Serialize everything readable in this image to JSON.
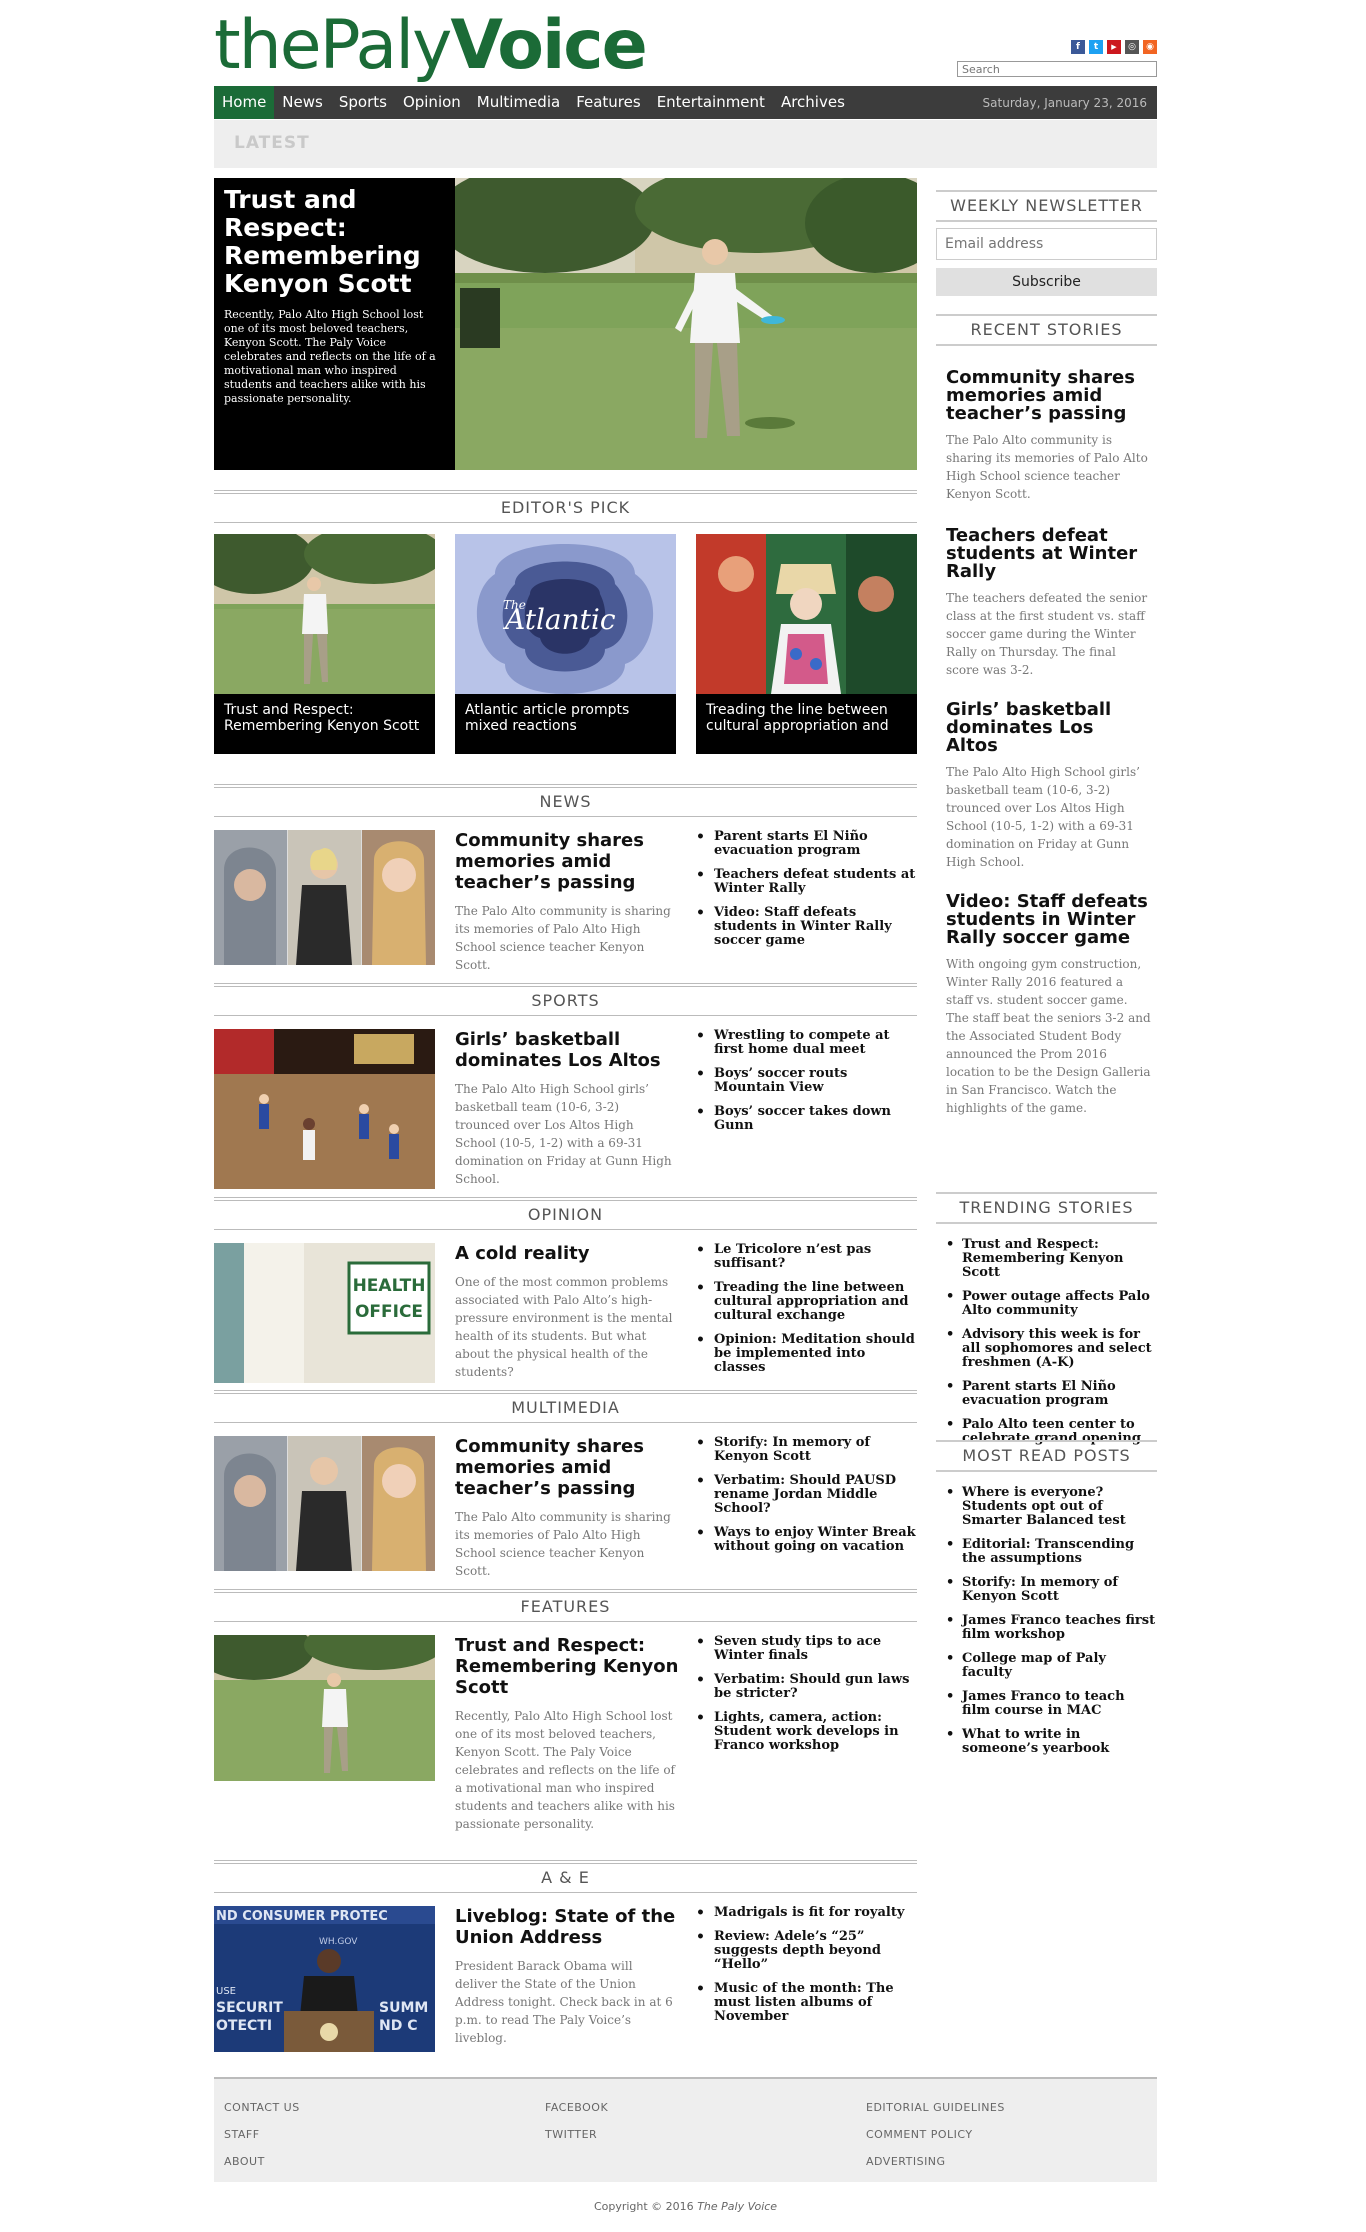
{
  "header": {
    "logo_part1": "the",
    "logo_part2": "Paly",
    "logo_part3": "Voice",
    "search_placeholder": "Search",
    "social": [
      {
        "icon": "facebook-icon",
        "glyph": "f",
        "color": "#3b5998"
      },
      {
        "icon": "twitter-icon",
        "glyph": "t",
        "color": "#1da1f2"
      },
      {
        "icon": "youtube-icon",
        "glyph": "▶",
        "color": "#cc181e"
      },
      {
        "icon": "instagram-icon",
        "glyph": "◎",
        "color": "#555555"
      },
      {
        "icon": "rss-icon",
        "glyph": "◉",
        "color": "#f26522"
      }
    ]
  },
  "nav": {
    "items": [
      "Home",
      "News",
      "Sports",
      "Opinion",
      "Multimedia",
      "Features",
      "Entertainment",
      "Archives"
    ],
    "date": "Saturday, January 23, 2016"
  },
  "latest": "LATEST",
  "hero": {
    "title": "Trust and Respect: Remembering Kenyon Scott",
    "description": "Recently, Palo Alto High School lost one of its most beloved teachers, Kenyon Scott. The Paly Voice celebrates and reflects on the life of a motivational man who inspired students and teachers alike with his passionate personality."
  },
  "editors_pick": {
    "heading": "EDITOR'S PICK",
    "items": [
      "Trust and Respect: Remembering Kenyon Scott",
      "Atlantic article prompts mixed reactions",
      "Treading the line between cultural appropriation and"
    ],
    "atlantic_logo": "Atlantic",
    "atlantic_the": "The"
  },
  "sections": [
    {
      "heading": "NEWS",
      "title": "Community shares memories amid teacher’s passing",
      "desc": "The Palo Alto community is sharing its memories of Palo Alto High School science teacher Kenyon Scott.",
      "links": [
        "Parent starts El Niño evacuation program",
        "Teachers defeat students at Winter Rally",
        "Video: Staff defeats students in Winter Rally soccer game"
      ]
    },
    {
      "heading": "SPORTS",
      "title": "Girls’ basketball dominates Los Altos",
      "desc": "The Palo Alto High School girls’ basketball team (10-6, 3-2) trounced over Los Altos High School (10-5, 1-2) with a 69-31 domination on Friday at Gunn High School.",
      "links": [
        "Wrestling to compete at first home dual meet",
        "Boys’ soccer routs Mountain View",
        "Boys’ soccer takes down Gunn"
      ]
    },
    {
      "heading": "OPINION",
      "title": "A cold reality",
      "desc": "One of the most common problems associated with Palo Alto’s high-pressure environment is the mental health of its students. But what about the physical health of the students?",
      "links": [
        "Le Tricolore n’est pas suffisant?",
        "Treading the line between cultural appropriation and cultural exchange",
        "Opinion: Meditation should be implemented into classes"
      ],
      "sign_line1": "HEALTH",
      "sign_line2": "OFFICE"
    },
    {
      "heading": "MULTIMEDIA",
      "title": "Community shares memories amid teacher’s passing",
      "desc": "The Palo Alto community is sharing its memories of Palo Alto High School science teacher Kenyon Scott.",
      "links": [
        "Storify: In memory of Kenyon Scott",
        "Verbatim: Should PAUSD rename Jordan Middle School?",
        "Ways to enjoy Winter Break without going on vacation"
      ]
    },
    {
      "heading": "FEATURES",
      "title": "Trust and Respect: Remembering Kenyon Scott",
      "desc": "Recently, Palo Alto High School lost one of its most beloved teachers, Kenyon Scott. The Paly Voice celebrates and reflects on the life of a motivational man who inspired students and teachers alike with his passionate personality.",
      "links": [
        "Seven study tips to ace Winter finals",
        "Verbatim: Should gun laws be stricter?",
        "Lights, camera, action: Student work develops in Franco workshop"
      ]
    },
    {
      "heading": "A & E",
      "title": "Liveblog: State of the Union Address",
      "desc": "President Barack Obama will deliver the State of the Union Address tonight. Check back in at 6 p.m. to read The Paly Voice’s liveblog.",
      "links": [
        "Madrigals is fit for royalty",
        "Review: Adele’s “25” suggests depth beyond “Hello”",
        "Music of the month: The must listen albums of November"
      ],
      "banner_top": "ND CONSUMER PROTEC",
      "banner_mid": "WH.GOV",
      "banner_l1": "USE",
      "banner_l2": "SECURIT",
      "banner_l3": "OTECTI",
      "banner_r1": "SUMM",
      "banner_r2": "ND C"
    }
  ],
  "sidebar": {
    "newsletter_heading": "WEEKLY NEWSLETTER",
    "email_placeholder": "Email address",
    "subscribe_label": "Subscribe",
    "recent_heading": "RECENT STORIES",
    "recent": [
      {
        "title": "Community shares memories amid teacher’s passing",
        "desc": "The Palo Alto community is sharing its memories of Palo Alto High School science teacher Kenyon Scott."
      },
      {
        "title": "Teachers defeat students at Winter Rally",
        "desc": "The teachers defeated the senior class at the first student vs. staff soccer game during the Winter Rally on Thursday. The final score was 3-2."
      },
      {
        "title": "Girls’ basketball dominates Los Altos",
        "desc": "The Palo Alto High School girls’ basketball team (10-6, 3-2) trounced over Los Altos High School (10-5, 1-2) with a 69-31 domination on Friday at Gunn High School."
      },
      {
        "title": "Video: Staff defeats students in Winter Rally soccer game",
        "desc": "With ongoing gym construction, Winter Rally 2016 featured a staff vs. student soccer game. The staff beat the seniors 3-2 and the Associated Student Body announced the Prom 2016 location to be the Design Galleria in San Francisco. Watch the highlights of the game."
      }
    ],
    "trending_heading": "TRENDING STORIES",
    "trending": [
      "Trust and Respect: Remembering Kenyon Scott",
      "Power outage affects Palo Alto community",
      "Advisory this week is for all sophomores and select freshmen (A-K)",
      "Parent starts El Niño evacuation program",
      "Palo Alto teen center to celebrate grand opening"
    ],
    "most_read_heading": "MOST READ POSTS",
    "most_read": [
      "Where is everyone? Students opt out of Smarter Balanced test",
      "Editorial: Transcending the assumptions",
      "Storify: In memory of Kenyon Scott",
      "James Franco teaches first film workshop",
      "College map of Paly faculty",
      "James Franco to teach film course in MAC",
      "What to write in someone’s yearbook"
    ]
  },
  "footer": {
    "links": [
      "CONTACT US",
      "STAFF",
      "ABOUT",
      "FACEBOOK",
      "TWITTER",
      "EDITORIAL GUIDELINES",
      "COMMENT POLICY",
      "ADVERTISING"
    ],
    "copyright": "Copyright © 2016",
    "copyright_name": "The Paly Voice"
  }
}
